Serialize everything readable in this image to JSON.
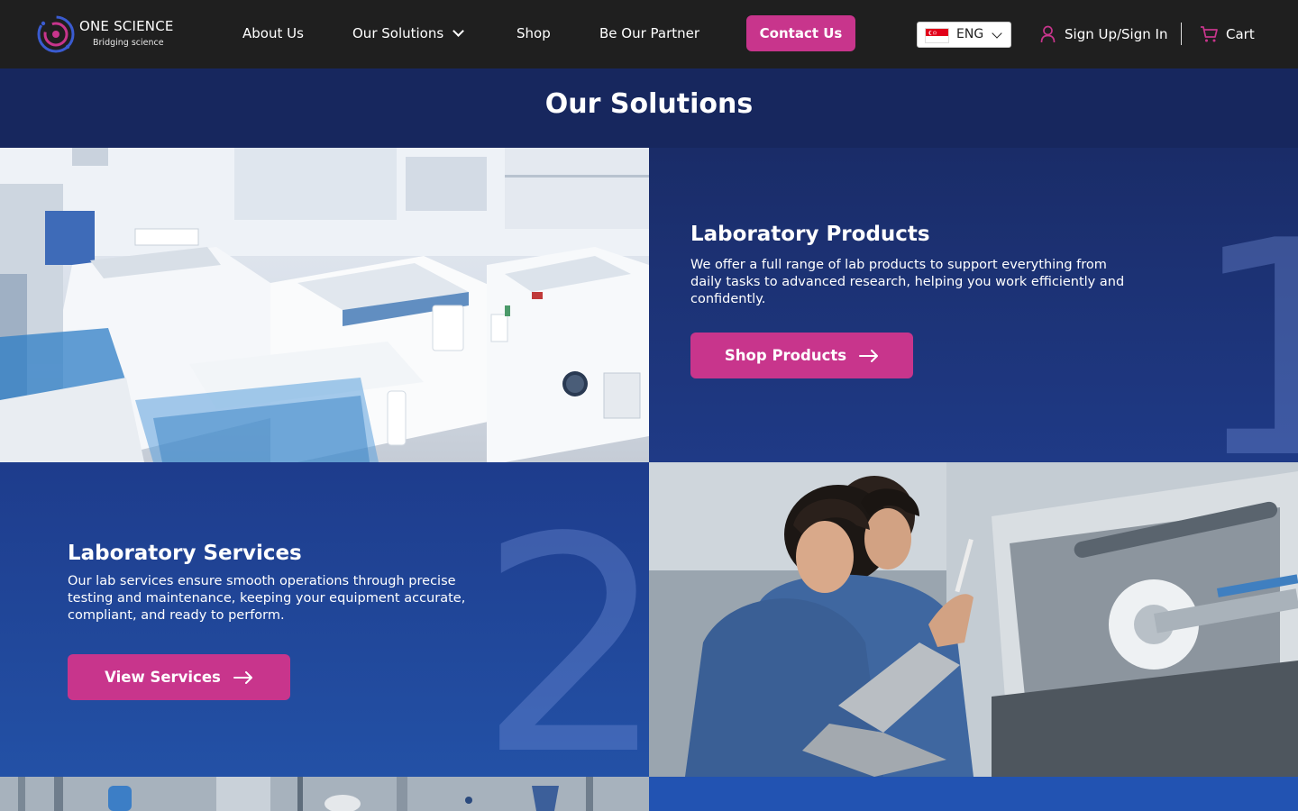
{
  "brand": {
    "name": "ONE SCIENCE",
    "tagline": "Bridging science",
    "primary_color": "#c8358c",
    "header_bg": "#1f1f1f",
    "section_bg": "#17275e"
  },
  "nav": {
    "about": "About Us",
    "solutions": "Our Solutions",
    "shop": "Shop",
    "partner": "Be Our Partner",
    "contact": "Contact Us"
  },
  "language": {
    "selected": "ENG",
    "flag": "singapore-flag-icon"
  },
  "account": {
    "signin": "Sign Up/Sign In",
    "cart": "Cart"
  },
  "section": {
    "title": "Our Solutions"
  },
  "solutions": [
    {
      "number": "1",
      "title": "Laboratory Products",
      "description": "We offer a full range of lab products to support everything from daily tasks to advanced research, helping you work efficiently and confidently.",
      "button": "Shop Products"
    },
    {
      "number": "2",
      "title": "Laboratory Services",
      "description": "Our lab services ensure smooth operations through precise testing and maintenance, keeping your equipment accurate, compliant, and ready to perform.",
      "button": "View Services"
    }
  ]
}
